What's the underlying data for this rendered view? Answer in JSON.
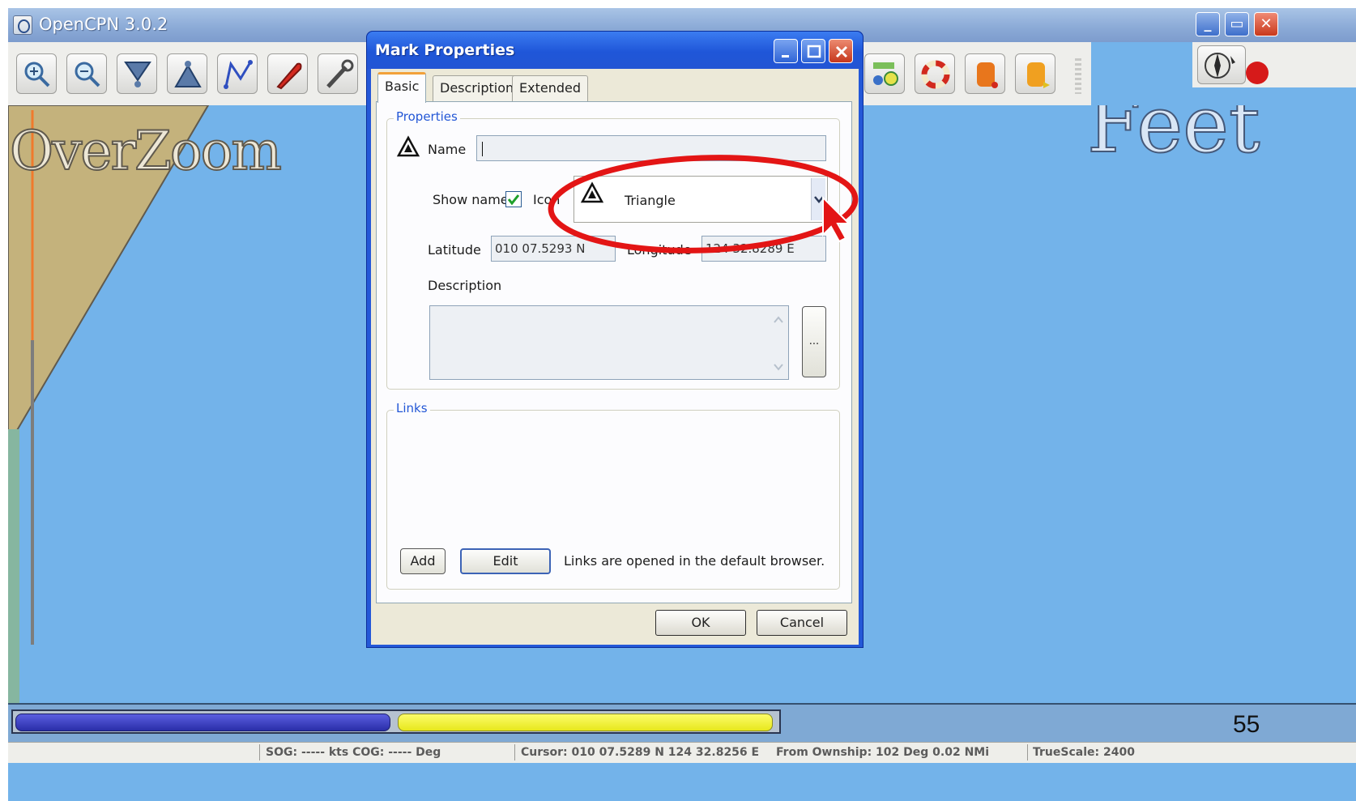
{
  "app": {
    "title": "OpenCPN 3.0.2",
    "chart_overlay_text": "OverZoom",
    "units_overlay_text": "Feet"
  },
  "toolbar": {
    "left_icons": [
      "zoom-in-icon",
      "zoom-out-icon",
      "scale-down-icon",
      "scale-up-icon",
      "create-route-icon",
      "auto-follow-icon",
      "settings-icon"
    ],
    "right_icons": [
      "ais-icon",
      "man-overboard-icon",
      "tide-icon",
      "current-icon"
    ],
    "compass_icons": [
      "compass-icon",
      "gps-status-icon"
    ]
  },
  "dialog": {
    "title": "Mark Properties",
    "tabs": [
      {
        "label": "Basic",
        "active": true
      },
      {
        "label": "Description",
        "active": false
      },
      {
        "label": "Extended",
        "active": false
      }
    ],
    "properties": {
      "legend": "Properties",
      "name_label": "Name",
      "name_value": "",
      "show_name_label": "Show name",
      "show_name_checked": true,
      "icon_label": "Icon",
      "icon_value": "Triangle",
      "latitude_label": "Latitude",
      "latitude_value": "010 07.5293 N",
      "longitude_label": "Longitude",
      "longitude_value": "124 32.8289 E",
      "description_label": "Description",
      "description_value": "",
      "description_more_label": "..."
    },
    "links": {
      "legend": "Links",
      "add_label": "Add",
      "edit_label": "Edit",
      "note": "Links are opened in the default browser."
    },
    "ok_label": "OK",
    "cancel_label": "Cancel"
  },
  "progress": {
    "page_number": "55"
  },
  "status": {
    "sog": "SOG: ----- kts  COG: ----- Deg",
    "cursor": "Cursor: 010 07.5289 N 124 32.8256 E",
    "from_ownship": "From Ownship: 102 Deg   0.02 NMi",
    "truescale": "TrueScale:   2400"
  },
  "colors": {
    "water": "#73b3ea",
    "land": "#c4b27c",
    "dialog_frame": "#2458d8",
    "highlight_annotation": "#e31515"
  }
}
